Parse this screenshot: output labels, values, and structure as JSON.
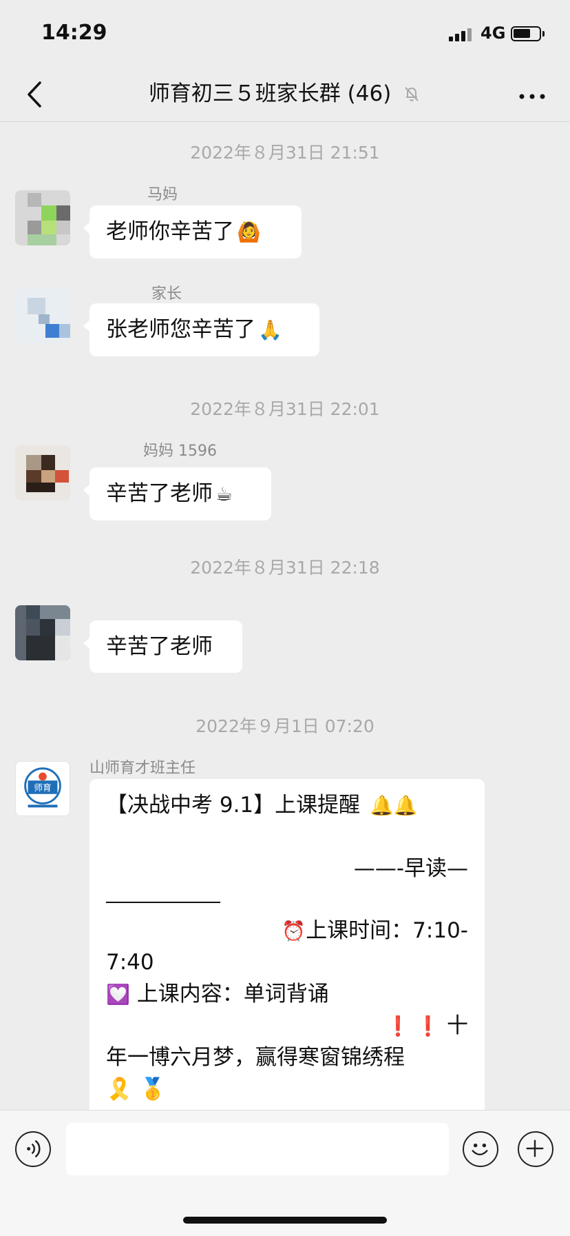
{
  "status_bar": {
    "time": "14:29",
    "network": "4G"
  },
  "header": {
    "title": "师育初三５班家长群 (46)"
  },
  "messages": [
    {
      "timestamp": "2022年８月31日 21:51",
      "sender": "马妈",
      "text": "老师你辛苦了",
      "emoji": "🙆"
    },
    {
      "sender": "家长",
      "text": "张老师您辛苦了",
      "emoji": "🙏"
    },
    {
      "timestamp": "2022年８月31日 22:01",
      "sender": "妈妈 1596",
      "text": "辛苦了老师",
      "emoji": "☕"
    },
    {
      "timestamp": "2022年８月31日 22:18",
      "sender": "",
      "text": "辛苦了老师"
    },
    {
      "timestamp": "2022年９月1日 07:20",
      "sender": "山师育才班主任",
      "avatar_text": "师育",
      "lines": {
        "l1": "【决战中考 9.1】上课提醒",
        "l1_emoji": "🔔🔔",
        "l2": "——-早读—",
        "l4_emoji": "⏰",
        "l4": "上课时间：7:10-",
        "l5": "7:40",
        "l6_emoji": "💟",
        "l6": " 上课内容：单词背诵",
        "l7_emoji": "❗ ❗",
        "l7": " 十",
        "l8": "年一博六月梦，赢得寒窗锦绣程",
        "l9_emoji": "🎗️ 🥇"
      }
    }
  ],
  "icons": {
    "back": "chevron-left-icon",
    "mute": "bell-slash-icon",
    "more": "more-icon",
    "voice": "voice-icon",
    "emoji": "emoji-icon",
    "add": "plus-icon"
  }
}
